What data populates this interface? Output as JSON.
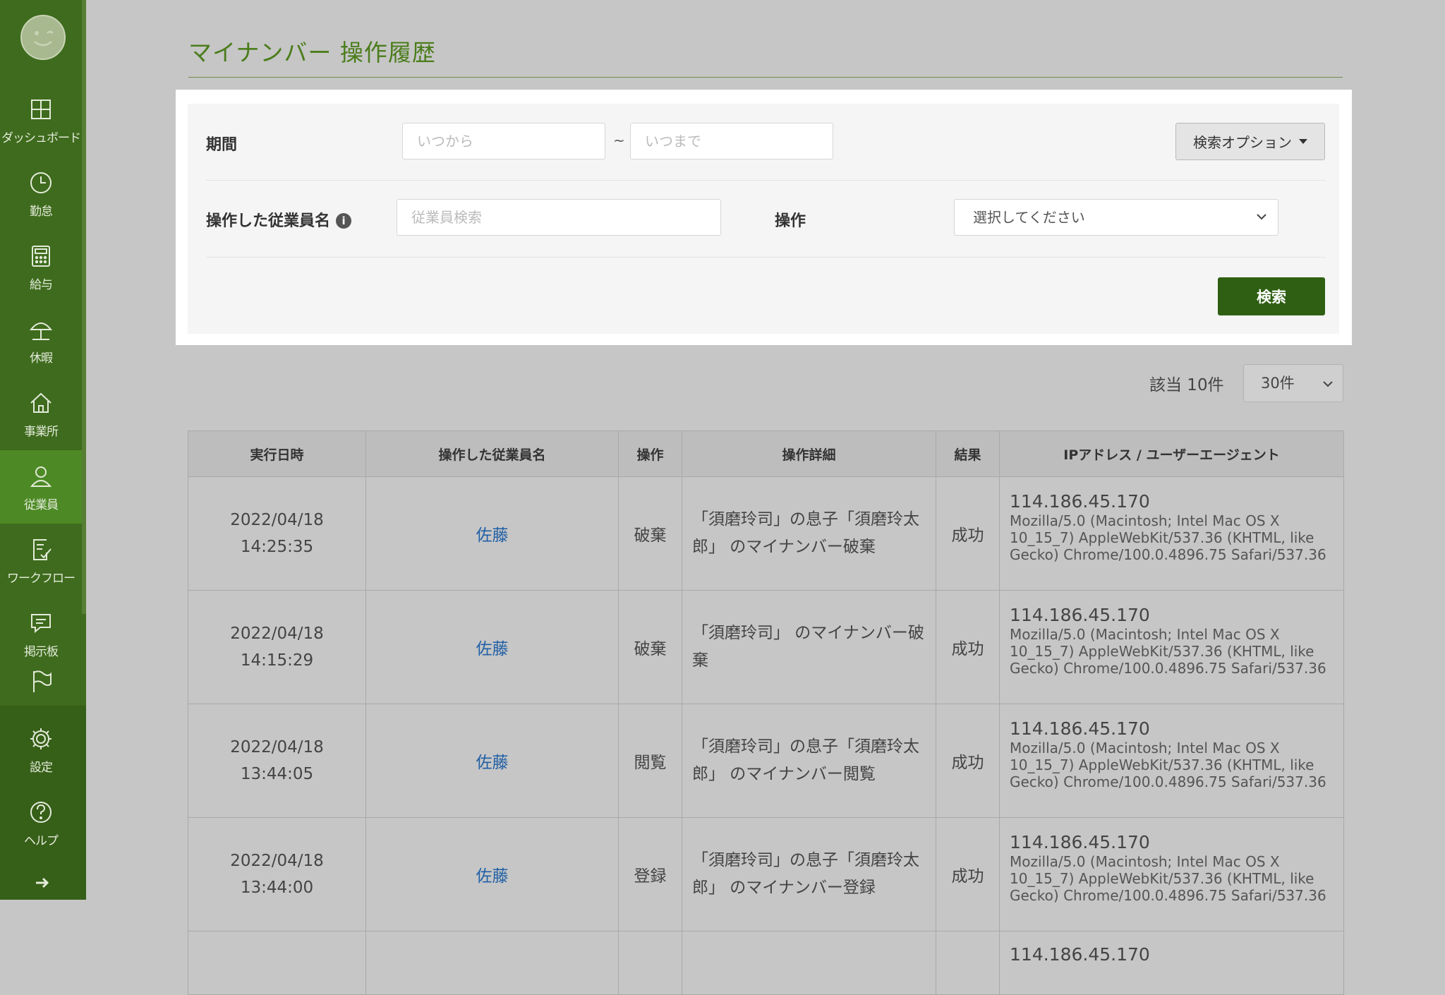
{
  "sidebar": {
    "items": [
      {
        "label": "ダッシュボード",
        "icon": "dashboard-icon"
      },
      {
        "label": "勤怠",
        "icon": "clock-icon"
      },
      {
        "label": "給与",
        "icon": "calculator-icon"
      },
      {
        "label": "休暇",
        "icon": "beach-umbrella-icon"
      },
      {
        "label": "事業所",
        "icon": "house-icon"
      },
      {
        "label": "従業員",
        "icon": "person-icon"
      },
      {
        "label": "ワークフロー",
        "icon": "checklist-icon"
      },
      {
        "label": "掲示板",
        "icon": "message-icon"
      },
      {
        "label": "",
        "icon": "flag-icon"
      },
      {
        "label": "設定",
        "icon": "gear-icon"
      },
      {
        "label": "ヘルプ",
        "icon": "help-icon"
      }
    ],
    "active": "従業員"
  },
  "page": {
    "title": "マイナンバー 操作履歴"
  },
  "search": {
    "period_label": "期間",
    "from_placeholder": "いつから",
    "tilde": "~",
    "to_placeholder": "いつまで",
    "options_button": "検索オプション",
    "employee_label": "操作した従業員名",
    "employee_placeholder": "従業員検索",
    "operation_label": "操作",
    "operation_select": "選択してください",
    "search_button": "検索"
  },
  "results": {
    "count_text": "該当 10件",
    "per_page": "30件"
  },
  "table": {
    "headers": [
      "実行日時",
      "操作した従業員名",
      "操作",
      "操作詳細",
      "結果",
      "IPアドレス / ユーザーエージェント"
    ],
    "rows": [
      {
        "date": "2022/04/18 14:25:35",
        "employee": "佐藤",
        "operation": "破棄",
        "detail": "「須磨玲司」の息子「須磨玲太郎」 のマイナンバー破棄",
        "result": "成功",
        "ip": "114.186.45.170",
        "ua": "Mozilla/5.0 (Macintosh; Intel Mac OS X 10_15_7) AppleWebKit/537.36 (KHTML, like Gecko) Chrome/100.0.4896.75 Safari/537.36"
      },
      {
        "date": "2022/04/18 14:15:29",
        "employee": "佐藤",
        "operation": "破棄",
        "detail": "「須磨玲司」 のマイナンバー破棄",
        "result": "成功",
        "ip": "114.186.45.170",
        "ua": "Mozilla/5.0 (Macintosh; Intel Mac OS X 10_15_7) AppleWebKit/537.36 (KHTML, like Gecko) Chrome/100.0.4896.75 Safari/537.36"
      },
      {
        "date": "2022/04/18 13:44:05",
        "employee": "佐藤",
        "operation": "閲覧",
        "detail": "「須磨玲司」の息子「須磨玲太郎」 のマイナンバー閲覧",
        "result": "成功",
        "ip": "114.186.45.170",
        "ua": "Mozilla/5.0 (Macintosh; Intel Mac OS X 10_15_7) AppleWebKit/537.36 (KHTML, like Gecko) Chrome/100.0.4896.75 Safari/537.36"
      },
      {
        "date": "2022/04/18 13:44:00",
        "employee": "佐藤",
        "operation": "登録",
        "detail": "「須磨玲司」の息子「須磨玲太郎」 のマイナンバー登録",
        "result": "成功",
        "ip": "114.186.45.170",
        "ua": "Mozilla/5.0 (Macintosh; Intel Mac OS X 10_15_7) AppleWebKit/537.36 (KHTML, like Gecko) Chrome/100.0.4896.75 Safari/537.36"
      },
      {
        "date": "",
        "employee": "",
        "operation": "",
        "detail": "",
        "result": "",
        "ip": "114.186.45.170",
        "ua": ""
      }
    ]
  }
}
